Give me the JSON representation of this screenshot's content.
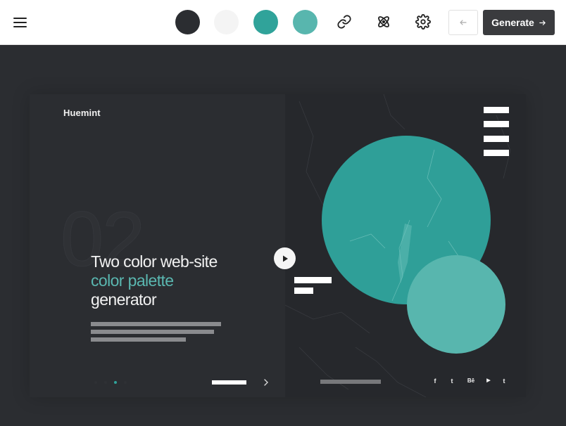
{
  "toolbar": {
    "swatches": [
      {
        "name": "swatch-dark",
        "color": "#2b2d31"
      },
      {
        "name": "swatch-light",
        "color": "#f4f4f4"
      },
      {
        "name": "swatch-teal",
        "color": "#30a39a"
      },
      {
        "name": "swatch-light-teal",
        "color": "#58b6ae"
      }
    ],
    "icons": [
      "link-icon",
      "atom-icon",
      "gear-icon"
    ],
    "back_icon": "arrow-left-icon",
    "generate_label": "Generate",
    "generate_icon": "arrow-right-icon"
  },
  "preview": {
    "brand": "Huemint",
    "slide_number": "02",
    "headline_part1": "Two color web-site ",
    "headline_accent": "color palette",
    "headline_part2": "generator",
    "social_icons": [
      "facebook-icon",
      "twitter-icon",
      "behance-icon",
      "youtube-icon",
      "tumblr-icon"
    ],
    "social_glyphs": [
      "f",
      "t",
      "Bē",
      "▶",
      "t"
    ]
  },
  "colors": {
    "background": "#2b2d31",
    "accent": "#30a39a",
    "accent_light": "#58b6ae",
    "panel": "#26282c",
    "text": "#f2f2f2"
  }
}
